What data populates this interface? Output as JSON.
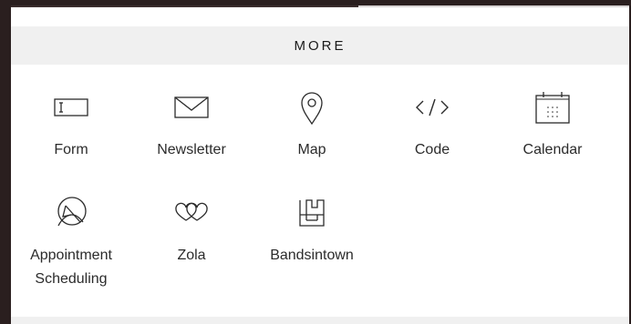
{
  "section": {
    "title": "MORE"
  },
  "blocks": [
    {
      "label": "Form",
      "icon": "form-icon"
    },
    {
      "label": "Newsletter",
      "icon": "envelope-icon"
    },
    {
      "label": "Map",
      "icon": "map-pin-icon"
    },
    {
      "label": "Code",
      "icon": "code-icon"
    },
    {
      "label": "Calendar",
      "icon": "calendar-icon"
    },
    {
      "label": "Appointment\nScheduling",
      "icon": "appointment-icon"
    },
    {
      "label": "Zola",
      "icon": "zola-icon"
    },
    {
      "label": "Bandsintown",
      "icon": "bandsintown-icon"
    }
  ],
  "colors": {
    "icon_stroke": "#2b2b2b",
    "header_bg": "#f0f0f0",
    "frame": "#2a1f1f"
  }
}
